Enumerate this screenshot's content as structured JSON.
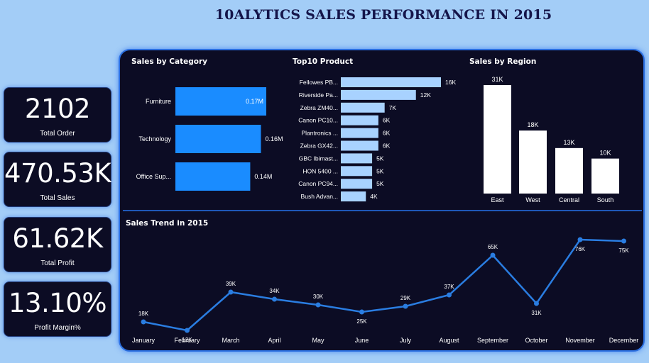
{
  "colors": {
    "background": "#a3cdf7",
    "panel": "#0c0c24",
    "category_bar": "#1a8cff",
    "product_bar": "#a8d2ff",
    "region_bar": "#ffffff",
    "trend_line": "#2a7de1"
  },
  "page_title": "10ALYTICS SALES PERFORMANCE IN 2015",
  "kpis": [
    {
      "value": "2102",
      "label": "Total Order"
    },
    {
      "value": "470.53K",
      "label": "Total Sales"
    },
    {
      "value": "61.62K",
      "label": "Total Profit"
    },
    {
      "value": "13.10%",
      "label": "Profit Margin%"
    }
  ],
  "chart_data": [
    {
      "type": "bar",
      "orientation": "horizontal",
      "title": "Sales by Category",
      "categories": [
        "Furniture",
        "Technology",
        "Office Sup..."
      ],
      "values": [
        0.17,
        0.16,
        0.14
      ],
      "value_labels": [
        "0.17M",
        "0.16M",
        "0.14M"
      ],
      "unit": "M"
    },
    {
      "type": "bar",
      "orientation": "horizontal",
      "title": "Top10 Product",
      "categories": [
        "Fellowes PB...",
        "Riverside Pa...",
        "Zebra ZM40...",
        "Canon PC10...",
        "Plantronics ...",
        "Zebra GX42...",
        "GBC Ibimast...",
        "HON 5400 ...",
        "Canon PC94...",
        "Bush Advan..."
      ],
      "values": [
        16,
        12,
        7,
        6,
        6,
        6,
        5,
        5,
        5,
        4
      ],
      "value_labels": [
        "16K",
        "12K",
        "7K",
        "6K",
        "6K",
        "6K",
        "5K",
        "5K",
        "5K",
        "4K"
      ],
      "unit": "K"
    },
    {
      "type": "bar",
      "title": "Sales by Region",
      "categories": [
        "East",
        "West",
        "Central",
        "South"
      ],
      "values": [
        31,
        18,
        13,
        10
      ],
      "value_labels": [
        "31K",
        "18K",
        "13K",
        "10K"
      ],
      "unit": "K"
    },
    {
      "type": "line",
      "title": "Sales Trend in 2015",
      "categories": [
        "January",
        "February",
        "March",
        "April",
        "May",
        "June",
        "July",
        "August",
        "September",
        "October",
        "November",
        "December"
      ],
      "values": [
        18,
        12,
        39,
        34,
        30,
        25,
        29,
        37,
        65,
        31,
        76,
        75
      ],
      "value_labels": [
        "18K",
        "12K",
        "39K",
        "34K",
        "30K",
        "25K",
        "29K",
        "37K",
        "65K",
        "31K",
        "76K",
        "75K"
      ],
      "unit": "K"
    }
  ]
}
